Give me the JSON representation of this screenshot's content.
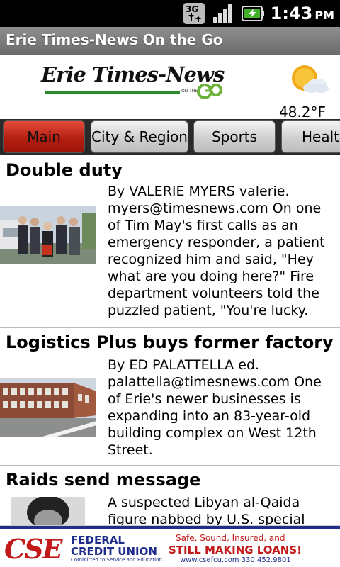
{
  "status_bar": {
    "network": "3G",
    "time": "1:43",
    "ampm": "PM",
    "icons": [
      "3g-data-icon",
      "signal-strength-icon",
      "battery-charging-icon"
    ]
  },
  "app": {
    "title": "Erie Times-News On the Go"
  },
  "header": {
    "logo_text": "Erie Times-News",
    "logo_sub": "ON THE",
    "weather_icon": "partly-cloudy-icon",
    "temperature": "48.2°F"
  },
  "tabs": [
    {
      "label": "Main",
      "active": true
    },
    {
      "label": "City & Region",
      "active": false
    },
    {
      "label": "Sports",
      "active": false
    },
    {
      "label": "Health",
      "active": false
    }
  ],
  "articles": [
    {
      "headline": "Double duty",
      "summary": "By VALERIE MYERS valerie. myers@timesnews.com On one of Tim May's first calls as an emergency responder, a patient recognized him and said, \"Hey what are you doing here?\" Fire department volunteers told the puzzled patient, \"You're lucky."
    },
    {
      "headline": "Logistics Plus buys former factory",
      "summary": "By ED PALATTELLA ed. palattella@timesnews.com One of Erie's newer businesses is expanding into an 83-year-old building complex on West 12th Street."
    },
    {
      "headline": "Raids send message",
      "summary": "A suspected Libyan al-Qaida figure nabbed by U.S. special forces in a"
    }
  ],
  "ad": {
    "brand": "CSE",
    "line1": "FEDERAL",
    "line2": "CREDIT UNION",
    "tagline": "Committed to Service and Education",
    "right1": "Safe, Sound, Insured, and",
    "right2": "STILL MAKING LOANS!",
    "right3": "www.csefcu.com     330.452.9801"
  },
  "colors": {
    "tab_active": "#c0281a",
    "title_bar": "#7a7a7a",
    "ad_blue": "#1f2e8a",
    "ad_red": "#c21a1a"
  }
}
